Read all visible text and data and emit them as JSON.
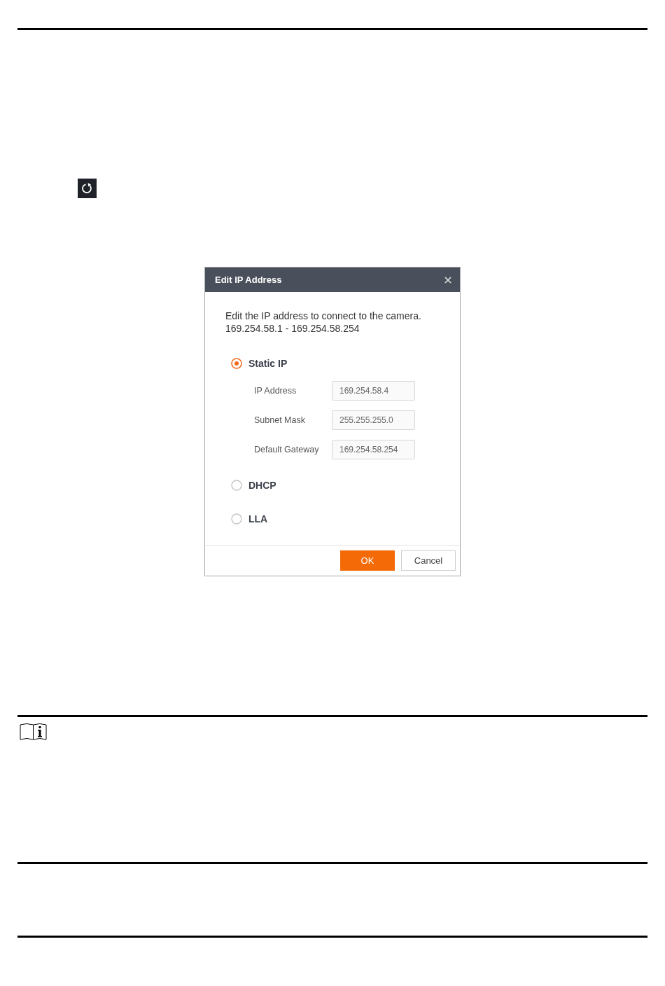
{
  "dialog": {
    "title": "Edit IP Address",
    "description": "Edit the IP address to connect to the camera.",
    "range": "169.254.58.1 - 169.254.58.254",
    "options": [
      {
        "label": "Static IP",
        "selected": true,
        "fields": [
          {
            "label": "IP Address",
            "value": "169.254.58.4"
          },
          {
            "label": "Subnet Mask",
            "value": "255.255.255.0"
          },
          {
            "label": "Default Gateway",
            "value": "169.254.58.254"
          }
        ]
      },
      {
        "label": "DHCP",
        "selected": false
      },
      {
        "label": "LLA",
        "selected": false
      }
    ],
    "buttons": [
      {
        "label": "OK",
        "kind": "primary"
      },
      {
        "label": "Cancel",
        "kind": "secondary"
      }
    ]
  }
}
